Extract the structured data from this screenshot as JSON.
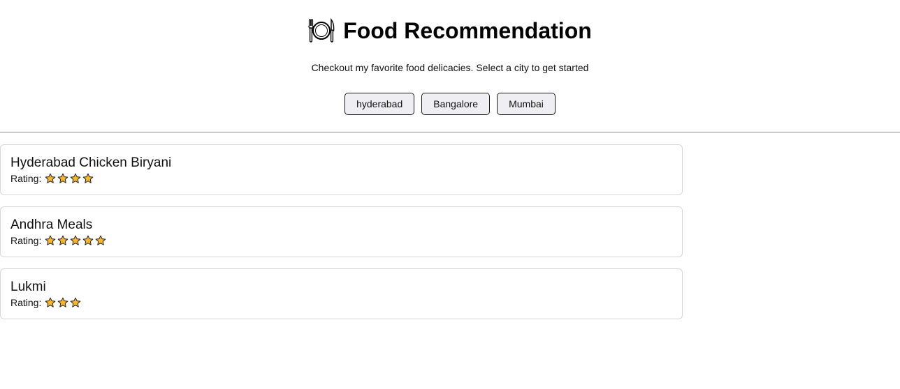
{
  "header": {
    "title": "Food Recommendation",
    "title_icon": "fork-plate-knife-icon",
    "subtitle": "Checkout my favorite food delicacies. Select a city to get started"
  },
  "cities": [
    {
      "label": "hyderabad"
    },
    {
      "label": "Bangalore"
    },
    {
      "label": "Mumbai"
    }
  ],
  "foods": [
    {
      "name": "Hyderabad Chicken Biryani",
      "rating_label": "Rating:",
      "rating": 4
    },
    {
      "name": "Andhra Meals",
      "rating_label": "Rating:",
      "rating": 5
    },
    {
      "name": "Lukmi",
      "rating_label": "Rating:",
      "rating": 3
    }
  ],
  "colors": {
    "star_fill": "#f7b733",
    "star_stroke": "#1a1a1a",
    "button_bg": "#efeff3"
  }
}
